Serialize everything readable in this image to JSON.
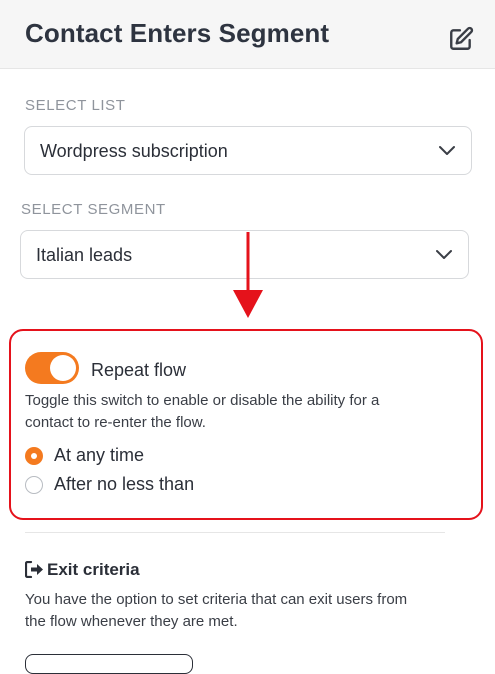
{
  "header": {
    "title": "Contact Enters Segment",
    "edit_icon": "edit-icon"
  },
  "list_section": {
    "label": "SELECT LIST",
    "selected": "Wordpress subscription"
  },
  "segment_section": {
    "label": "SELECT SEGMENT",
    "selected": "Italian leads"
  },
  "repeat_flow": {
    "label": "Repeat flow",
    "enabled": true,
    "description_line1": "Toggle this switch to enable or disable the ability for a",
    "description_line2": "contact to re-enter the flow.",
    "options": [
      {
        "label": "At any time",
        "selected": true
      },
      {
        "label": "After no less than",
        "selected": false
      }
    ]
  },
  "exit": {
    "title": "Exit criteria",
    "icon": "sign-out-icon",
    "description_line1": "You have the option to set criteria that can exit users from",
    "description_line2": "the flow whenever they are met."
  },
  "colors": {
    "accent": "#f47a1f",
    "highlight_border": "#e5121b",
    "annotation_arrow": "#e5121b"
  }
}
